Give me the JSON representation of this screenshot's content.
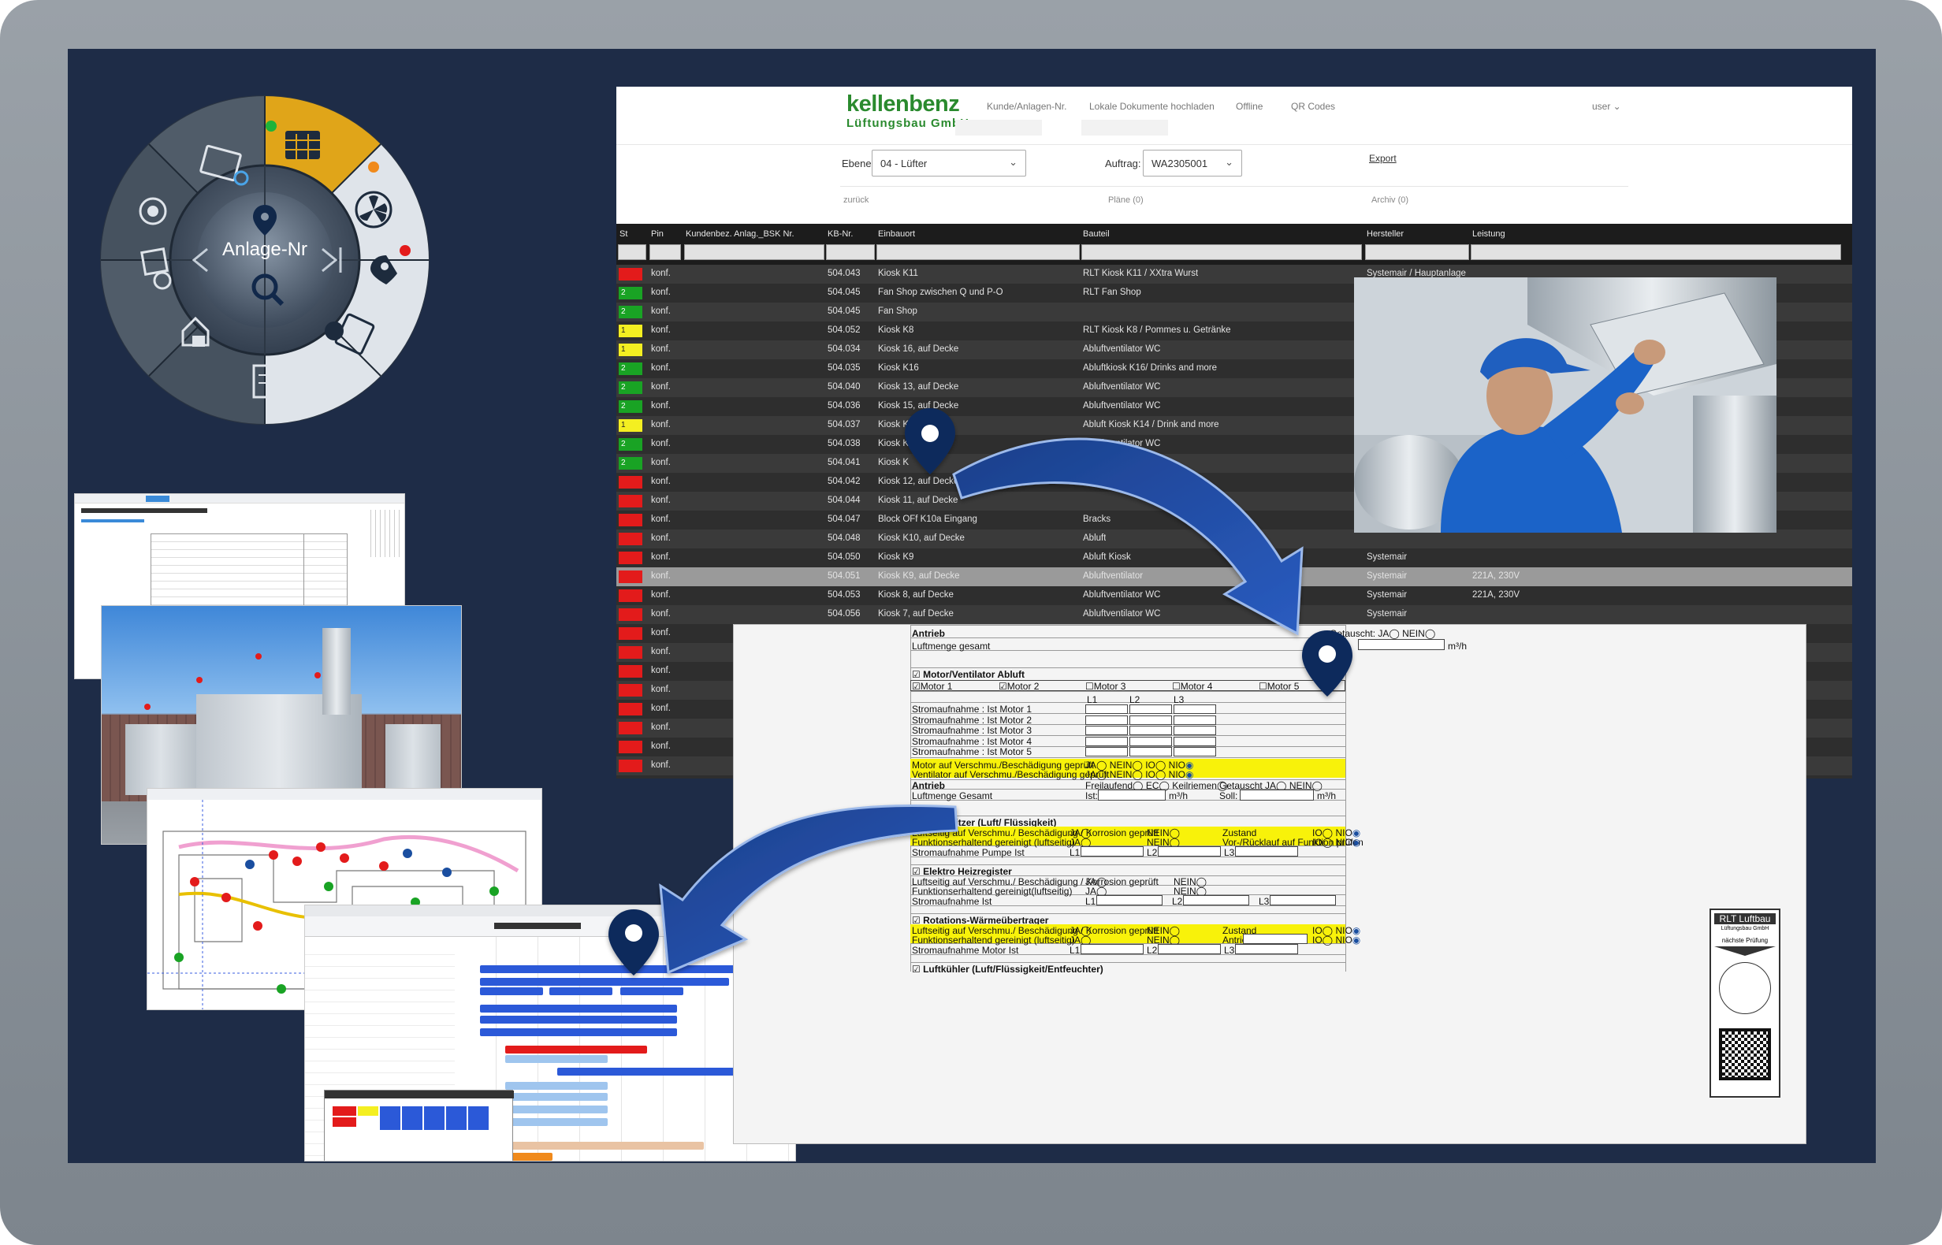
{
  "wheel": {
    "center_label": "Anlage-Nr",
    "icons": [
      "calendar-grid-icon",
      "fan-icon",
      "map-pin-icon",
      "checklist-icon",
      "document-edit-icon",
      "house-icon",
      "photo-icon",
      "headset-icon",
      "browser-settings-icon"
    ]
  },
  "app": {
    "logo_name": "kellenbenz",
    "logo_sub": "Lüftungsbau GmbH",
    "nav": [
      "Kunde/Anlagen-Nr.",
      "Lokale Dokumente hochladen",
      "Offline",
      "QR Codes",
      "user"
    ],
    "filter_ebene_label": "Ebene:",
    "filter_ebene_value": "04 - Lüfter",
    "filter_auftrag_label": "Auftrag:",
    "filter_auftrag_value": "WA2305001",
    "export_label": "Export",
    "back_link": "zurück",
    "plans_link": "Pläne (0)",
    "archive_link": "Archiv (0)",
    "columns": [
      "St",
      "Pin",
      "Kundenbez. Anlag._BSK Nr.",
      "KB-Nr.",
      "Einbauort",
      "Bauteil",
      "Hersteller",
      "Leistung"
    ],
    "rows": [
      {
        "status": "red",
        "pin": "konf.",
        "kb": "504.043",
        "einbauort": "Kiosk K11",
        "bauteil": "RLT Kiosk K11 / XXtra Wurst",
        "hersteller": "Systemair / Hauptanlage",
        "leistung": ""
      },
      {
        "status": "green",
        "num": "2",
        "pin": "konf.",
        "kb": "504.045",
        "einbauort": "Fan Shop zwischen Q und P-O",
        "bauteil": "RLT Fan Shop",
        "hersteller": "",
        "leistung": ""
      },
      {
        "status": "green",
        "num": "2",
        "pin": "konf.",
        "kb": "504.045",
        "einbauort": "Fan Shop",
        "bauteil": "",
        "hersteller": "",
        "leistung": ""
      },
      {
        "status": "yellow",
        "num": "1",
        "pin": "konf.",
        "kb": "504.052",
        "einbauort": "Kiosk K8",
        "bauteil": "RLT Kiosk K8 / Pommes u. Getränke",
        "hersteller": "",
        "leistung": ""
      },
      {
        "status": "yellow",
        "num": "1",
        "pin": "konf.",
        "kb": "504.034",
        "einbauort": "Kiosk 16, auf Decke",
        "bauteil": "Abluftventilator WC",
        "hersteller": "",
        "leistung": ""
      },
      {
        "status": "green",
        "num": "2",
        "pin": "konf.",
        "kb": "504.035",
        "einbauort": "Kiosk K16",
        "bauteil": "Abluftkiosk K16/ Drinks and more",
        "hersteller": "",
        "leistung": ""
      },
      {
        "status": "green",
        "num": "2",
        "pin": "konf.",
        "kb": "504.040",
        "einbauort": "Kiosk 13, auf Decke",
        "bauteil": "Abluftventilator WC",
        "hersteller": "",
        "leistung": ""
      },
      {
        "status": "green",
        "num": "2",
        "pin": "konf.",
        "kb": "504.036",
        "einbauort": "Kiosk 15, auf Decke",
        "bauteil": "Abluftventilator WC",
        "hersteller": "",
        "leistung": ""
      },
      {
        "status": "yellow",
        "num": "1",
        "pin": "konf.",
        "kb": "504.037",
        "einbauort": "Kiosk K14",
        "bauteil": "Abluft Kiosk K14 / Drink and more",
        "hersteller": "",
        "leistung": ""
      },
      {
        "status": "green",
        "num": "2",
        "pin": "konf.",
        "kb": "504.038",
        "einbauort": "Kiosk K",
        "bauteil": "Abluftventilator WC",
        "hersteller": "",
        "leistung": ""
      },
      {
        "status": "green",
        "num": "2",
        "pin": "konf.",
        "kb": "504.041",
        "einbauort": "Kiosk K",
        "bauteil": "K12 / Drinks and More",
        "hersteller": "",
        "leistung": ""
      },
      {
        "status": "red",
        "pin": "konf.",
        "kb": "504.042",
        "einbauort": "Kiosk 12, auf Decke",
        "bauteil": "",
        "hersteller": "",
        "leistung": ""
      },
      {
        "status": "red",
        "pin": "konf.",
        "kb": "504.044",
        "einbauort": "Kiosk 11, auf Decke",
        "bauteil": "",
        "hersteller": "",
        "leistung": ""
      },
      {
        "status": "red",
        "pin": "konf.",
        "kb": "504.047",
        "einbauort": "Block OFf K10a Eingang",
        "bauteil": "Bracks",
        "hersteller": "",
        "leistung": ""
      },
      {
        "status": "red",
        "pin": "konf.",
        "kb": "504.048",
        "einbauort": "Kiosk K10, auf Decke",
        "bauteil": "Abluft",
        "hersteller": "",
        "leistung": ""
      },
      {
        "status": "red",
        "pin": "konf.",
        "kb": "504.050",
        "einbauort": "Kiosk K9",
        "bauteil": "Abluft Kiosk",
        "hersteller": "Systemair",
        "leistung": ""
      },
      {
        "status": "red",
        "pin": "konf.",
        "kb": "504.051",
        "einbauort": "Kiosk K9, auf Decke",
        "bauteil": "Abluftventilator",
        "hersteller": "Systemair",
        "leistung": "221A, 230V"
      },
      {
        "status": "red",
        "pin": "konf.",
        "kb": "504.053",
        "einbauort": "Kiosk 8, auf Decke",
        "bauteil": "Abluftventilator WC",
        "hersteller": "Systemair",
        "leistung": "221A, 230V"
      },
      {
        "status": "red",
        "pin": "konf.",
        "kb": "504.056",
        "einbauort": "Kiosk 7, auf Decke",
        "bauteil": "Abluftventilator WC",
        "hersteller": "Systemair",
        "leistung": ""
      },
      {
        "status": "red",
        "pin": "konf.",
        "kb": "",
        "einbauort": "",
        "bauteil": "",
        "hersteller": "",
        "leistung": ""
      },
      {
        "status": "red",
        "pin": "konf.",
        "kb": "",
        "einbauort": "",
        "bauteil": "",
        "hersteller": "",
        "leistung": ""
      },
      {
        "status": "red",
        "pin": "konf.",
        "kb": "",
        "einbauort": "",
        "bauteil": "",
        "hersteller": "",
        "leistung": ""
      },
      {
        "status": "red",
        "pin": "konf.",
        "kb": "",
        "einbauort": "",
        "bauteil": "",
        "hersteller": "",
        "leistung": ""
      },
      {
        "status": "red",
        "pin": "konf.",
        "kb": "",
        "einbauort": "",
        "bauteil": "",
        "hersteller": "",
        "leistung": ""
      },
      {
        "status": "red",
        "pin": "konf.",
        "kb": "",
        "einbauort": "",
        "bauteil": "",
        "hersteller": "",
        "leistung": ""
      },
      {
        "status": "red",
        "pin": "konf.",
        "kb": "",
        "einbauort": "",
        "bauteil": "",
        "hersteller": "",
        "leistung": ""
      },
      {
        "status": "red",
        "pin": "konf.",
        "kb": "",
        "einbauort": "",
        "bauteil": "",
        "hersteller": "",
        "leistung": ""
      },
      {
        "status": "red",
        "pin": "konf.",
        "kb": "",
        "einbauort": "",
        "bauteil": "",
        "hersteller": "",
        "leistung": ""
      }
    ]
  },
  "form": {
    "antrieb": "Antrieb",
    "luftmenge_gesamt": "Luftmenge gesamt",
    "getauscht": "Getauscht: JA",
    "nein": "NEIN",
    "soll": "Soll:",
    "unit_m3h": "m³/h",
    "motor_section": "Motor/Ventilator Abluft",
    "motors": [
      "Motor 1",
      "Motor 2",
      "Motor 3",
      "Motor 4",
      "Motor 5"
    ],
    "phases": [
      "L1",
      "L2",
      "L3"
    ],
    "strom_motor": [
      "Stromaufnahme : Ist Motor 1",
      "Stromaufnahme : Ist Motor 2",
      "Stromaufnahme : Ist Motor 3",
      "Stromaufnahme : Ist Motor 4",
      "Stromaufnahme : Ist Motor 5"
    ],
    "motor_check1": "Motor auf Verschmu./Beschädigung geprüft",
    "motor_check2": "Ventilator auf Verschmu./Beschädigung geprüft",
    "ja": "JA",
    "nein2": "NEIN",
    "io": "IO",
    "nio": "NIO",
    "antrieb2": "Antrieb",
    "freilaufend": "Freilaufend",
    "ec": "EC",
    "keilriemen": "Keilriemen",
    "getauscht2": "Getauscht JA",
    "luftmenge_gesamt2": "Luftmenge Gesamt",
    "ist": "Ist:",
    "lufterhitzer": "Lufterhitzer (Luft/ Flüssigkeit)",
    "le_row1": "Luftseitig auf Verschmu./ Beschädigung / Korrosion geprüft",
    "le_row2": "Funktionserhaltend gereinigt (luftseitig)",
    "zustand": "Zustand",
    "vor_ruecklauf": "Vor-/Rücklauf auf Funktion prüfen",
    "strom_pumpe": "Stromaufnahme Pumpe Ist",
    "l1": "L1:",
    "l2": "L2:",
    "l3": "L3:",
    "elektro": "Elektro Heizregister",
    "el_row1": "Luftseitig auf Verschmu./ Beschädigung / Korrosion geprüft",
    "el_row2": "Funktionserhaltend gereinigt(luftseitig)",
    "strom_ist": "Stromaufnahme Ist",
    "rotation": "Rotations-Wärmeübertrager",
    "rot_row1": "Luftseitig auf Verschmu./ Beschädigung / Korrosion geprüft",
    "rot_row2": "Funktionserhaltend gereinigt (luftseitig)",
    "antrieb3": "Antrieb",
    "strom_motor_ist": "Stromaufnahme Motor Ist",
    "luftkuehler": "Luftkühler (Luft/Flüssigkeit/Entfeuchter)",
    "sticker_title": "RLT Luftbau",
    "sticker_sub": "Lüftungsbau GmbH",
    "sticker_next": "nächste Prüfung"
  },
  "colors": {
    "accent_yellow": "#e0a519",
    "table_dark": "#2b2b2b",
    "status_red": "#e31b1b",
    "status_green": "#19a324",
    "status_yellow": "#f4ef21",
    "arrow_blue": "#1a4ea0"
  }
}
